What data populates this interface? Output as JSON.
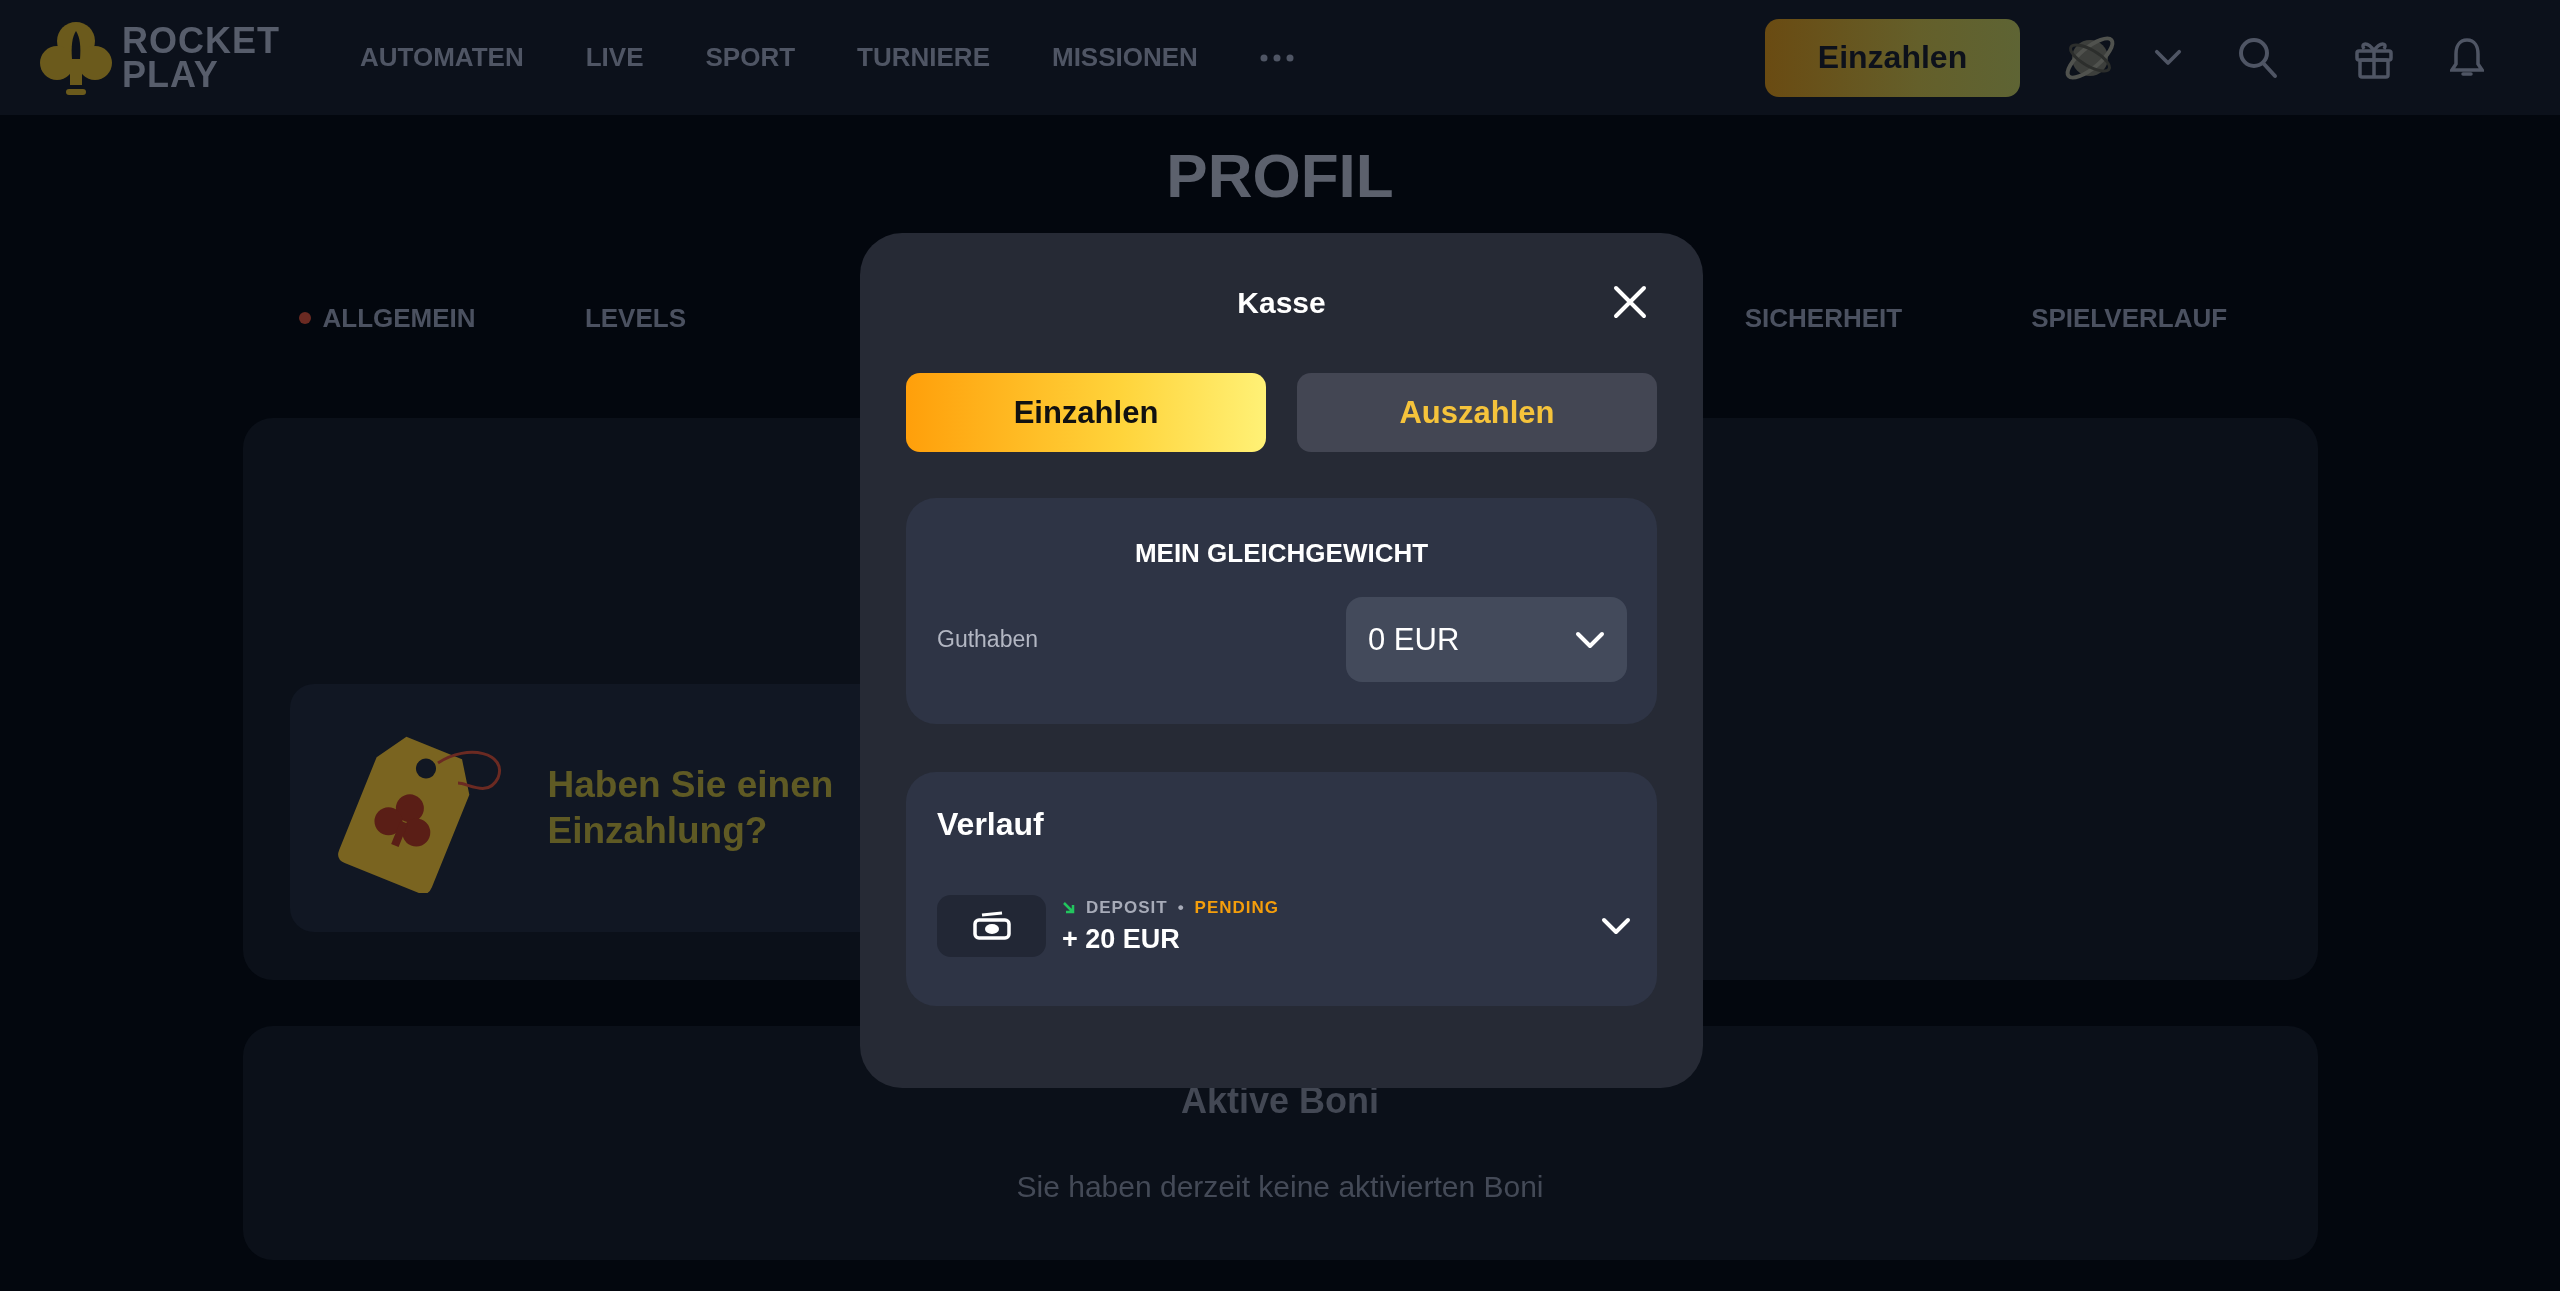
{
  "header": {
    "logo": {
      "line_1": "ROCKET",
      "line_2": "PLAY"
    },
    "nav": [
      {
        "label": "AUTOMATEN"
      },
      {
        "label": "LIVE"
      },
      {
        "label": "SPORT"
      },
      {
        "label": "TURNIERE"
      },
      {
        "label": "MISSIONEN"
      }
    ],
    "deposit_button": "Einzahlen"
  },
  "page_title": "PROFIL",
  "tabs": [
    {
      "label": "ALLGEMEIN",
      "selected": false,
      "alert": true
    },
    {
      "label": "LEVELS",
      "selected": false,
      "alert": false
    },
    {
      "label": "SICHERHEIT",
      "selected": false,
      "alert": false
    },
    {
      "label": "SPIELVERLAUF",
      "selected": false,
      "alert": false
    }
  ],
  "promo": {
    "lines": [
      "Haben Sie einen",
      "Einzahlung?"
    ]
  },
  "active_bonuses": {
    "title": "Aktive Boni",
    "empty_text": "Sie haben derzeit keine aktivierten Boni"
  },
  "cashier": {
    "title": "Kasse",
    "tabs": [
      {
        "label": "Einzahlen",
        "selected": true
      },
      {
        "label": "Auszahlen",
        "selected": false
      }
    ],
    "balance": {
      "title": "MEIN GLEICHGEWICHT",
      "label": "Guthaben",
      "value": "0 EUR"
    },
    "history": {
      "title": "Verlauf",
      "transactions": [
        {
          "type": "DEPOSIT",
          "separator": "•",
          "status": "PENDING",
          "amount": "+ 20 EUR"
        }
      ]
    }
  }
}
